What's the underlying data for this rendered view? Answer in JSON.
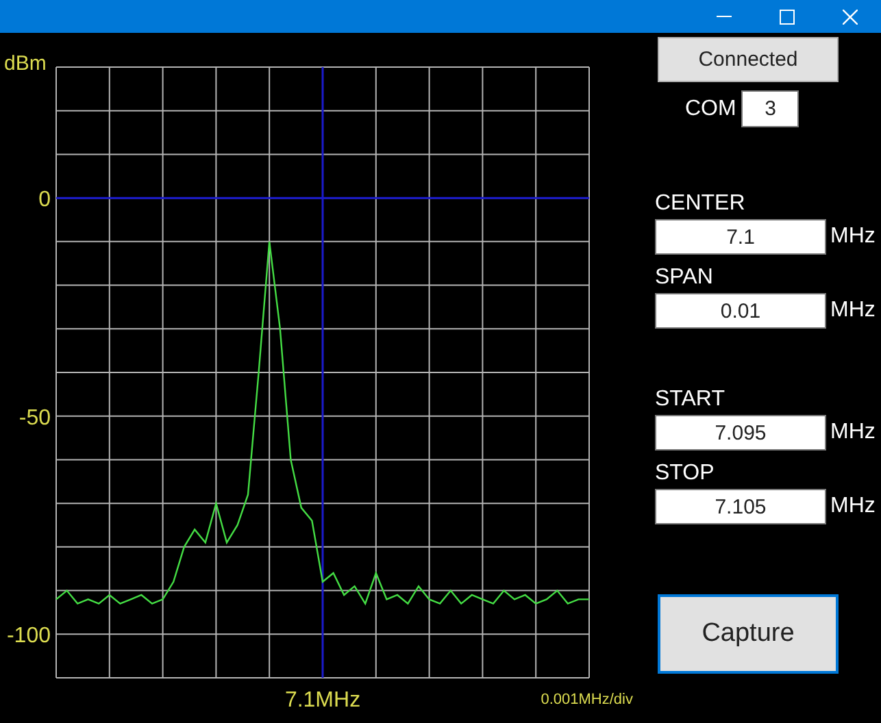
{
  "connect_button": {
    "label": "Connected"
  },
  "port": {
    "label": "COM",
    "value": "3"
  },
  "frequency_groups": [
    [
      {
        "label": "CENTER",
        "value": "7.1",
        "unit": "MHz"
      },
      {
        "label": "SPAN",
        "value": "0.01",
        "unit": "MHz"
      }
    ],
    [
      {
        "label": "START",
        "value": "7.095",
        "unit": "MHz"
      },
      {
        "label": "STOP",
        "value": "7.105",
        "unit": "MHz"
      }
    ]
  ],
  "capture_button": {
    "label": "Capture"
  },
  "spectrum": {
    "scale_label": "0.001MHz/div",
    "chart_data": {
      "type": "line",
      "ylabel": "dBm",
      "grid": true,
      "ylim": [
        -110,
        30
      ],
      "yticks": [
        {
          "value": 0,
          "label": "0"
        },
        {
          "value": -50,
          "label": "-50"
        },
        {
          "value": -100,
          "label": "-100"
        }
      ],
      "annotations": [
        {
          "text": "7.1MHz"
        }
      ],
      "series": [
        {
          "color": "#44dd44",
          "values": [
            -92,
            -90,
            -93,
            -92,
            -93,
            -91,
            -93,
            -92,
            -91,
            -93,
            -92,
            -88,
            -80,
            -76,
            -79,
            -70,
            -79,
            -75,
            -68,
            -40,
            -10,
            -30,
            -60,
            -71,
            -74,
            -88,
            -86,
            -91,
            -89,
            -93,
            -86,
            -92,
            -91,
            -93,
            -89,
            -92,
            -93,
            -90,
            -93,
            -91,
            -92,
            -93,
            -90,
            -92,
            -91,
            -93,
            -92,
            -90,
            -93,
            -92,
            -92
          ]
        }
      ]
    }
  }
}
